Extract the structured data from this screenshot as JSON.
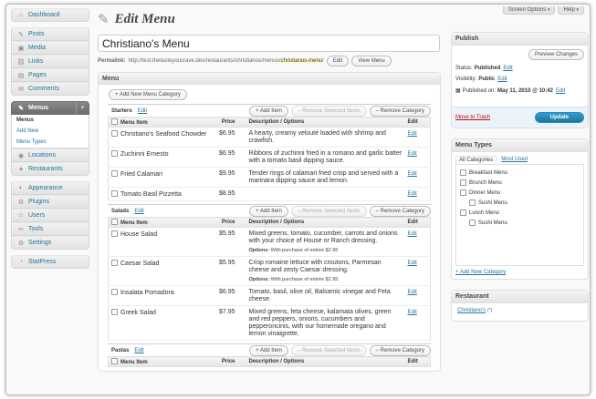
{
  "header": {
    "screen_options": "Screen Options",
    "help": "Help",
    "arrow": "▾"
  },
  "sidebar": {
    "groups": [
      {
        "items": [
          {
            "label": "Dashboard",
            "icon": "⌂"
          }
        ]
      },
      {
        "items": [
          {
            "label": "Posts",
            "icon": "✎"
          },
          {
            "label": "Media",
            "icon": "▣"
          },
          {
            "label": "Links",
            "icon": "⛓"
          },
          {
            "label": "Pages",
            "icon": "▤"
          },
          {
            "label": "Comments",
            "icon": "✉"
          }
        ]
      },
      {
        "active": {
          "label": "Menus",
          "icon": "✎",
          "toggle": "▼"
        },
        "sub": [
          "Menus",
          "Add New",
          "Menu Types"
        ],
        "items": [
          {
            "label": "Locations",
            "icon": "◉"
          },
          {
            "label": "Restaurants",
            "icon": "✦"
          }
        ]
      },
      {
        "items": [
          {
            "label": "Appearance",
            "icon": "◐"
          },
          {
            "label": "Plugins",
            "icon": "⚙"
          },
          {
            "label": "Users",
            "icon": "☺"
          },
          {
            "label": "Tools",
            "icon": "✂"
          },
          {
            "label": "Settings",
            "icon": "⚙"
          }
        ]
      },
      {
        "items": [
          {
            "label": "StatPress",
            "icon": "◔"
          }
        ]
      }
    ]
  },
  "main": {
    "title": "Edit Menu",
    "menu_name": "Christiano's Menu",
    "permalink_label": "Permalink:",
    "permalink_base": "http://test.thetasteyoucrave.dev/restaurants/christianos/menus/",
    "permalink_slug": "christianos-menu",
    "permalink_tail": "/",
    "edit_btn": "Edit",
    "view_btn": "View Menu",
    "box_title": "Menu",
    "add_category": "+ Add New Menu Category",
    "col_item": "Menu Item",
    "col_price": "Price",
    "col_desc": "Description / Options",
    "col_edit": "Edit",
    "add_item": "+ Add Item",
    "remove_selected": "– Remove Selected Items",
    "remove_category": "– Remove Category",
    "edit_link": "Edit",
    "categories": [
      {
        "name": "Starters",
        "items": [
          {
            "name": "Christiano's Seafood Chowder",
            "price": "$6.95",
            "desc": "A hearty, creamy velouté loaded with shrimp and crawfish.",
            "options": ""
          },
          {
            "name": "Zuchinni Ernesto",
            "price": "$6.95",
            "desc": "Ribbons of zuchinni fried in a romano and garlic batter with a tomato basil dipping sauce.",
            "options": ""
          },
          {
            "name": "Fried Calamari",
            "price": "$9.95",
            "desc": "Tender rings of calamari fried crisp and served with a marinara dipping sauce and lemon.",
            "options": ""
          },
          {
            "name": "Tomato Basil Pizzetta",
            "price": "$8.95",
            "desc": "",
            "options": ""
          }
        ]
      },
      {
        "name": "Salads",
        "items": [
          {
            "name": "House Salad",
            "price": "$5.95",
            "desc": "Mixed greens, tomato, cucumber, carrots and onions with your choice of House or Ranch dressing.",
            "options_label": "Options:",
            "options": "With purchase of entrée $2.95"
          },
          {
            "name": "Caesar Salad",
            "price": "$5.95",
            "desc": "Crisp romaine lettuce with croutons, Parmesan cheese and zesty Caesar dressing.",
            "options_label": "Options:",
            "options": "With purchase of entrée $2.95"
          },
          {
            "name": "Insalata Pomadora",
            "price": "$6.95",
            "desc": "Tomato, basil, olive oil, Balsamic vinegar and Feta cheese.",
            "options": ""
          },
          {
            "name": "Greek Salad",
            "price": "$7.95",
            "desc": "Mixed greens, feta cheese, kalamata olives, green and red peppers, onions, cucumbers and pepperoncinis, with our homemade oregano and lemon vinaigrette.",
            "options": ""
          }
        ]
      },
      {
        "name": "Pastas",
        "items": []
      }
    ]
  },
  "publish": {
    "title": "Publish",
    "preview": "Preview Changes",
    "status_label": "Status:",
    "status_value": "Published",
    "visibility_label": "Visibility:",
    "visibility_value": "Public",
    "published_label": "Published on:",
    "published_value": "May 11, 2010 @ 10:42",
    "edit": "Edit",
    "trash": "Move to Trash",
    "update": "Update",
    "cal_icon": "▦"
  },
  "menu_types": {
    "title": "Menu Types",
    "tab_all": "All Categories",
    "tab_used": "Most Used",
    "items": [
      {
        "label": "Breakfast Menu",
        "sub": false
      },
      {
        "label": "Brunch Menu",
        "sub": false
      },
      {
        "label": "Dinner Menu",
        "sub": false
      },
      {
        "label": "Sushi Menu",
        "sub": true
      },
      {
        "label": "Lunch Menu",
        "sub": false
      },
      {
        "label": "Sushi Menu",
        "sub": true
      }
    ],
    "add_new": "+ Add New Category"
  },
  "restaurant": {
    "title": "Restaurant",
    "name": "Christiano's",
    "marker": "(*)"
  },
  "colors": {
    "link": "#21759b",
    "active_menu": "#6d6d6d",
    "update_button": "#21759b",
    "trash": "#bc0b0b"
  }
}
